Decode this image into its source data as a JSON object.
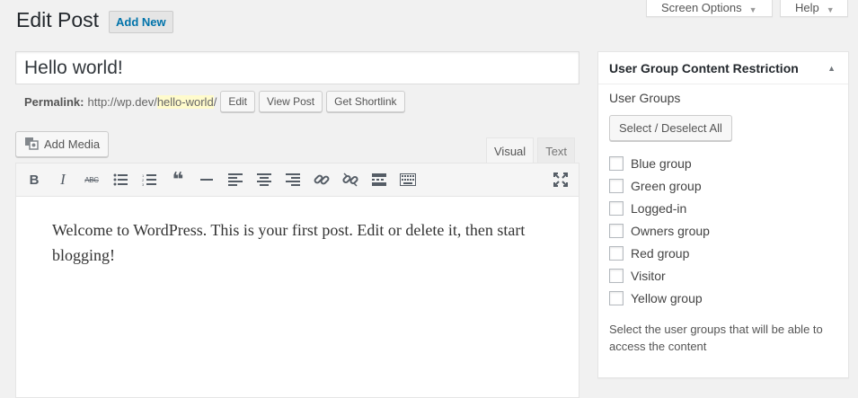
{
  "screen_meta": {
    "screen_options": "Screen Options",
    "help": "Help"
  },
  "page": {
    "title": "Edit Post",
    "add_new": "Add New"
  },
  "post": {
    "title": "Hello world!",
    "permalink_label": "Permalink:",
    "permalink_base": "http://wp.dev/",
    "permalink_slug": "hello-world",
    "permalink_trail": "/",
    "edit_btn": "Edit",
    "view_btn": "View Post",
    "shortlink_btn": "Get Shortlink"
  },
  "editor": {
    "add_media": "Add Media",
    "tab_visual": "Visual",
    "tab_text": "Text",
    "toolbar_icons": [
      "bold-icon",
      "italic-icon",
      "strikethrough-icon",
      "bullet-list-icon",
      "numbered-list-icon",
      "blockquote-icon",
      "horizontal-rule-icon",
      "align-left-icon",
      "align-center-icon",
      "align-right-icon",
      "link-icon",
      "unlink-icon",
      "read-more-icon",
      "toolbar-toggle-icon",
      "fullscreen-icon"
    ],
    "content": "Welcome to WordPress. This is your first post. Edit or delete it, then start blogging!"
  },
  "restriction_box": {
    "title": "User Group Content Restriction",
    "groups_label": "User Groups",
    "select_all": "Select / Deselect All",
    "groups": [
      {
        "label": "Blue group",
        "checked": false
      },
      {
        "label": "Green group",
        "checked": false
      },
      {
        "label": "Logged-in",
        "checked": false
      },
      {
        "label": "Owners group",
        "checked": false
      },
      {
        "label": "Red group",
        "checked": false
      },
      {
        "label": "Visitor",
        "checked": false
      },
      {
        "label": "Yellow group",
        "checked": false
      }
    ],
    "help": "Select the user groups that will be able to access the content"
  }
}
